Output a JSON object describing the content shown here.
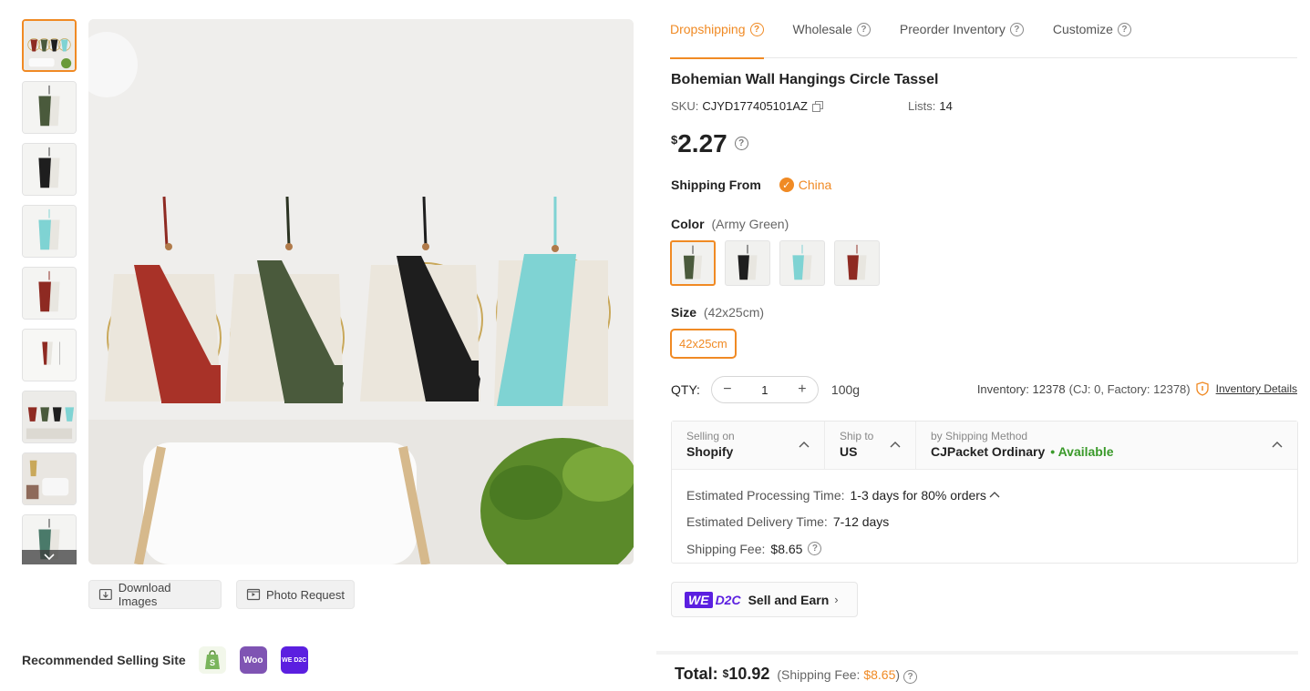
{
  "tabs": [
    {
      "label": "Dropshipping",
      "active": true
    },
    {
      "label": "Wholesale",
      "active": false
    },
    {
      "label": "Preorder Inventory",
      "active": false
    },
    {
      "label": "Customize",
      "active": false
    }
  ],
  "product": {
    "title": "Bohemian Wall Hangings Circle Tassel",
    "sku_label": "SKU:",
    "sku": "CJYD177405101AZ",
    "lists_label": "Lists:",
    "lists": "14",
    "currency": "$",
    "price": "2.27"
  },
  "shipping_from": {
    "label": "Shipping From",
    "value": "China"
  },
  "color": {
    "label": "Color",
    "selected": "(Army Green)",
    "swatch_colors": [
      "#4a5a3c",
      "#1e1e1e",
      "#7fd3d3",
      "#8e2a22"
    ]
  },
  "size": {
    "label": "Size",
    "selected": "(42x25cm)",
    "option": "42x25cm"
  },
  "qty": {
    "label": "QTY:",
    "minus": "−",
    "value": "1",
    "plus": "+",
    "weight": "100g"
  },
  "inventory": {
    "text": "Inventory: 12378",
    "detail": "(CJ: 0, Factory: 12378)",
    "link": "Inventory Details"
  },
  "shipping": {
    "selling_on_label": "Selling on",
    "selling_on": "Shopify",
    "ship_to_label": "Ship to",
    "ship_to": "US",
    "method_label": "by Shipping Method",
    "method": "CJPacket Ordinary",
    "availability": "• Available",
    "processing_label": "Estimated Processing Time:",
    "processing": "1-3 days for 80% orders",
    "delivery_label": "Estimated Delivery Time:",
    "delivery": "7-12 days",
    "fee_label": "Shipping Fee:",
    "fee": "$8.65"
  },
  "wed2c": {
    "we": "WE",
    "d2c": "D2C",
    "label": "Sell and Earn",
    "arrow": "›"
  },
  "images": {
    "download": "Download Images",
    "photo_request": "Photo Request"
  },
  "recommended": {
    "label": "Recommended Selling Site",
    "woo": "Woo",
    "wed2c_badge": "WE D2C"
  },
  "total": {
    "label": "Total:",
    "currency": "$",
    "amount": "10.92",
    "fee_prefix": "(Shipping Fee: ",
    "fee": "$8.65",
    "fee_suffix": ")"
  },
  "colors": {
    "accent": "#f08a24",
    "available": "#3a9a2a",
    "we_purple": "#5b1fe0"
  }
}
